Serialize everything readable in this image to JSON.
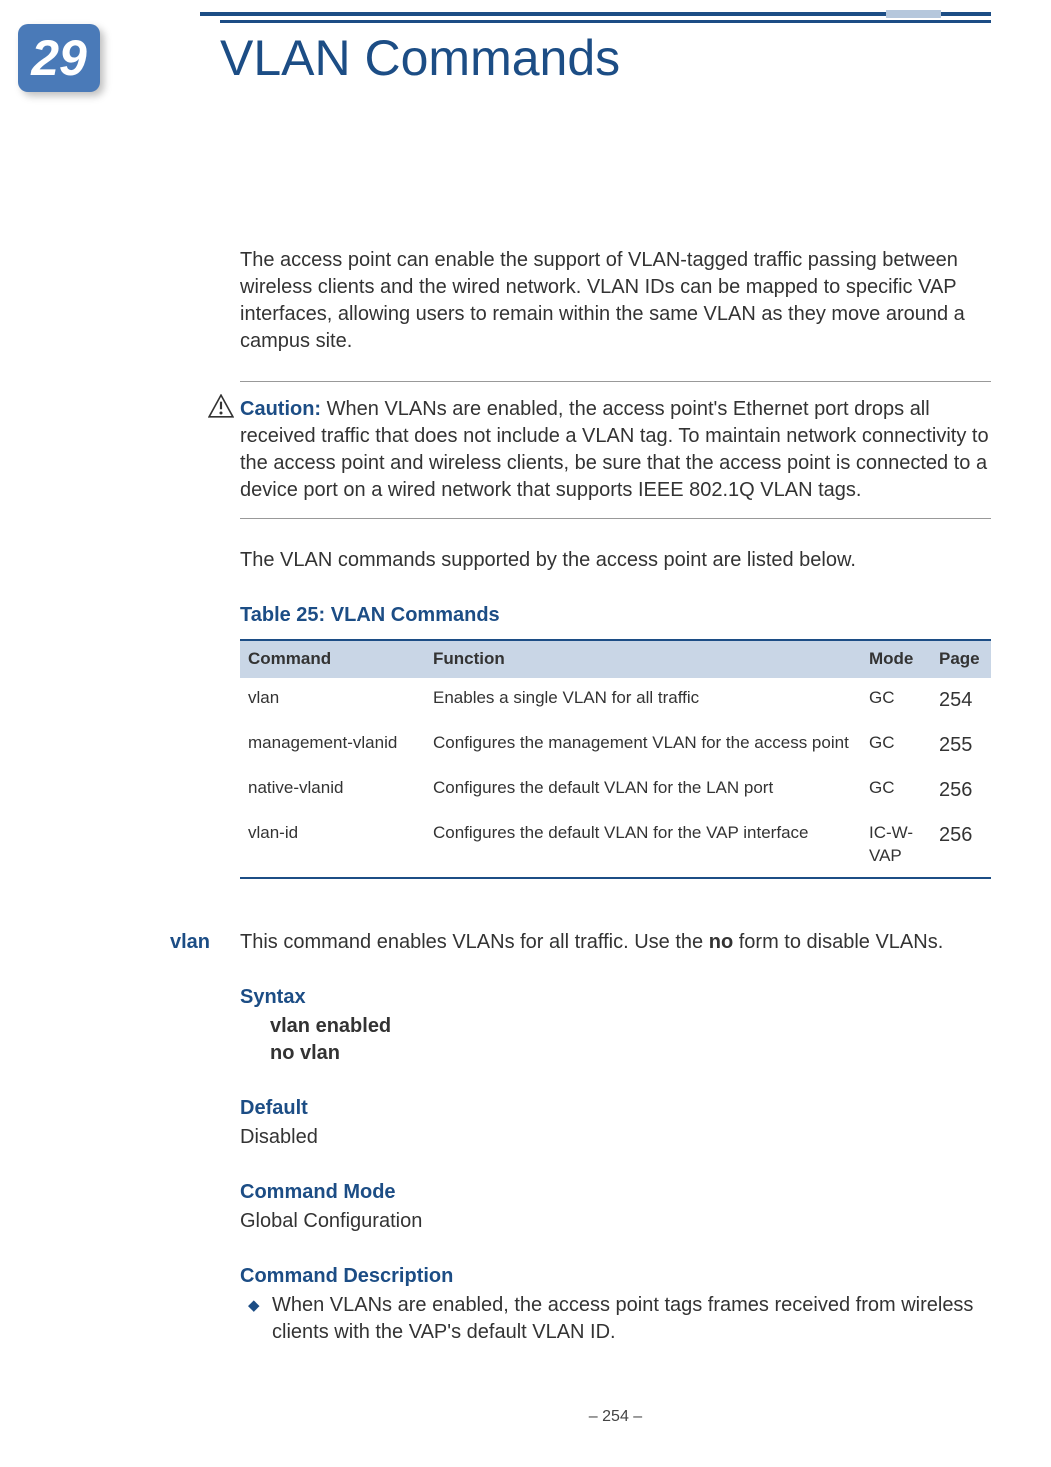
{
  "chapter_number": "29",
  "chapter_title": "VLAN Commands",
  "intro": "The access point can enable the support of VLAN-tagged traffic passing between wireless clients and the wired network. VLAN IDs can be mapped to specific VAP interfaces, allowing users to remain within the same VLAN as they move around a campus site.",
  "caution_label": "Caution:",
  "caution_text": " When VLANs are enabled, the access point's Ethernet port drops all received traffic that does not include a VLAN tag. To maintain network connectivity to the access point and wireless clients, be sure that the access point is connected to a device port on a wired network that supports IEEE 802.1Q VLAN tags.",
  "summary_line": "The VLAN commands supported by the access point are listed below.",
  "table_title": "Table 25: VLAN Commands",
  "table_headers": {
    "command": "Command",
    "function": "Function",
    "mode": "Mode",
    "page": "Page"
  },
  "table_rows": [
    {
      "command": "vlan",
      "function": "Enables a single VLAN for all traffic",
      "mode": "GC",
      "page": "254"
    },
    {
      "command": "management-vlanid",
      "function": "Configures the management VLAN for the access point",
      "mode": "GC",
      "page": "255"
    },
    {
      "command": "native-vlanid",
      "function": "Configures the default VLAN for the LAN port",
      "mode": "GC",
      "page": "256"
    },
    {
      "command": "vlan-id",
      "function": "Configures the default VLAN for the VAP interface",
      "mode": "IC-W-VAP",
      "page": "256"
    }
  ],
  "vlan_section": {
    "label": "vlan",
    "desc_pre": "This command enables VLANs for all traffic. Use the ",
    "no": "no",
    "desc_post": " form to disable VLANs.",
    "syntax_heading": "Syntax",
    "syntax_line1": "vlan enabled",
    "syntax_line2": "no vlan",
    "default_heading": "Default",
    "default_value": "Disabled",
    "mode_heading": "Command Mode",
    "mode_value": "Global Configuration",
    "desc_heading": "Command Description",
    "bullet1": "When VLANs are enabled, the access point tags frames received from wireless clients with the VAP's default VLAN ID."
  },
  "footer": "–  254  –"
}
